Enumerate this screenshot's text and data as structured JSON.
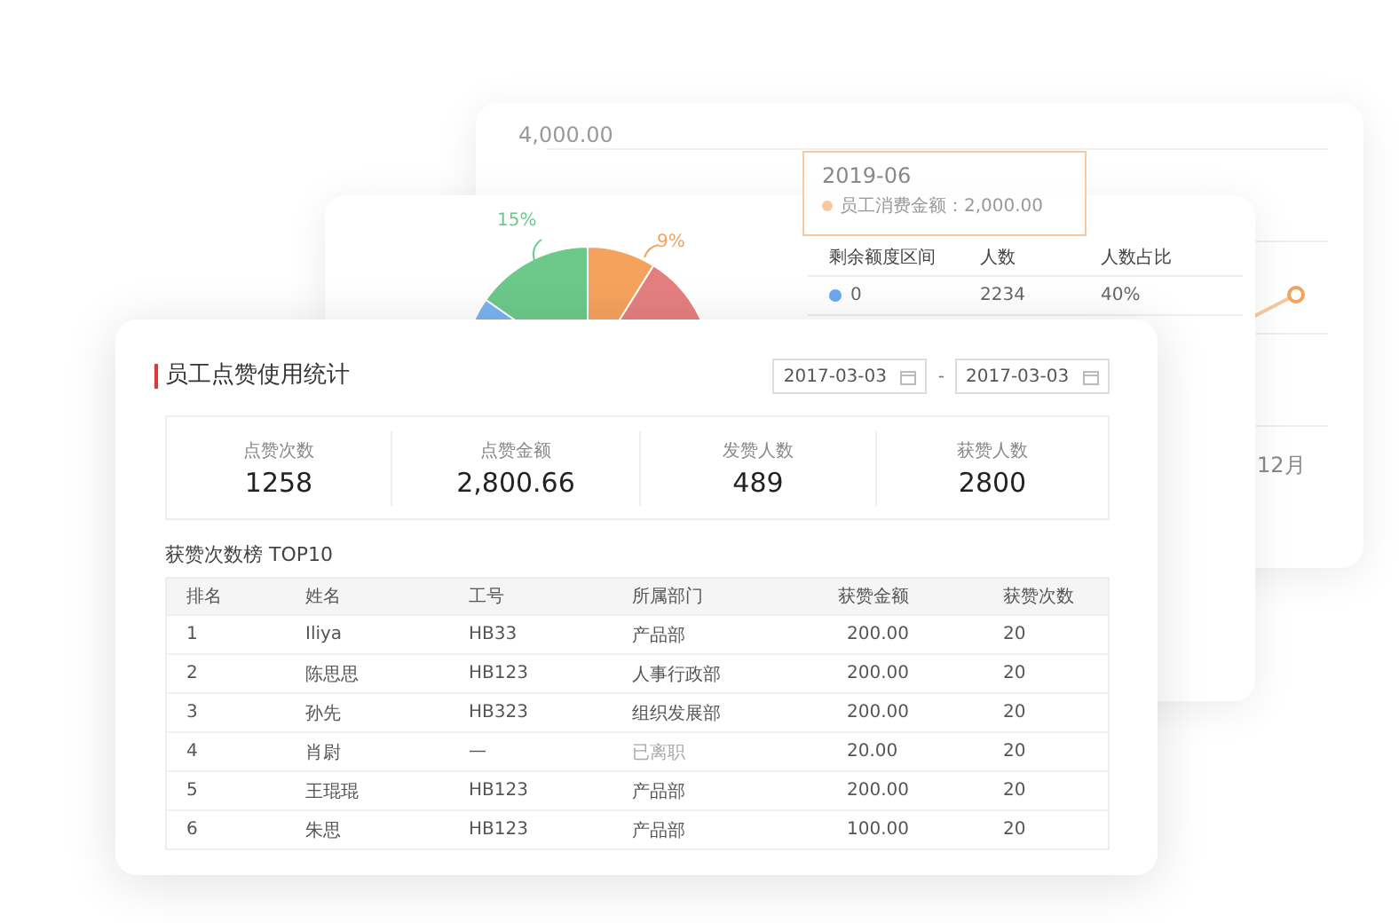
{
  "back_card": {
    "y_axis_label": "4,000.00",
    "x_axis_label": "12月",
    "tooltip": {
      "title": "2019-06",
      "series_label": "员工消费金额：2,000.00"
    }
  },
  "middle_card": {
    "pie_labels": [
      {
        "text": "15%",
        "color": "#6cc98a"
      },
      {
        "text": "9%",
        "color": "#f5a25d"
      }
    ],
    "table": {
      "columns": [
        "剩余额度区间",
        "人数",
        "人数占比"
      ],
      "rows": [
        {
          "range": "0",
          "count": "2234",
          "share": "40%",
          "color": "#6aa8f0"
        }
      ]
    }
  },
  "main": {
    "title": "员工点赞使用统计",
    "date_from": "2017-03-03",
    "separator": "-",
    "date_to": "2017-03-03",
    "stats": [
      {
        "label": "点赞次数",
        "value": "1258"
      },
      {
        "label": "点赞金额",
        "value": "2,800.66"
      },
      {
        "label": "发赞人数",
        "value": "489"
      },
      {
        "label": "获赞人数",
        "value": "2800"
      }
    ],
    "ranking_title": "获赞次数榜 TOP10",
    "table": {
      "columns": [
        "排名",
        "姓名",
        "工号",
        "所属部门",
        "获赞金额",
        "获赞次数"
      ],
      "rows": [
        {
          "rank": "1",
          "name": "Iliya",
          "id": "HB33",
          "dept": "产品部",
          "amount": "200.00",
          "count": "20",
          "inactive": false
        },
        {
          "rank": "2",
          "name": "陈思思",
          "id": "HB123",
          "dept": "人事行政部",
          "amount": "200.00",
          "count": "20",
          "inactive": false
        },
        {
          "rank": "3",
          "name": "孙先",
          "id": "HB323",
          "dept": "组织发展部",
          "amount": "200.00",
          "count": "20",
          "inactive": false
        },
        {
          "rank": "4",
          "name": "肖尉",
          "id": "—",
          "dept": "已离职",
          "amount": "20.00",
          "count": "20",
          "inactive": true
        },
        {
          "rank": "5",
          "name": "王琨琨",
          "id": "HB123",
          "dept": "产品部",
          "amount": "200.00",
          "count": "20",
          "inactive": false
        },
        {
          "rank": "6",
          "name": "朱思",
          "id": "HB123",
          "dept": "产品部",
          "amount": "100.00",
          "count": "20",
          "inactive": false
        }
      ]
    }
  }
}
